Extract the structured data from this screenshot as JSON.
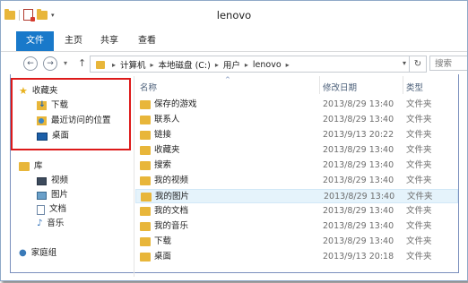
{
  "window": {
    "title": "lenovo"
  },
  "quick_access": {
    "dropdown_glyph": "▾"
  },
  "ribbon": {
    "tabs": [
      {
        "label": "文件"
      },
      {
        "label": "主页"
      },
      {
        "label": "共享"
      },
      {
        "label": "查看"
      }
    ]
  },
  "nav": {
    "back_glyph": "←",
    "forward_glyph": "→",
    "recent_glyph": "▾",
    "up_glyph": "↑",
    "breadcrumb": [
      "计算机",
      "本地磁盘 (C:)",
      "用户",
      "lenovo"
    ],
    "dropdown_glyph": "▾",
    "refresh_glyph": "↻",
    "search_placeholder": "搜索"
  },
  "sidebar": {
    "favorites_label": "收藏夹",
    "favorites": [
      {
        "label": "下载",
        "icon": "download-icon"
      },
      {
        "label": "最近访问的位置",
        "icon": "recent-places-icon"
      },
      {
        "label": "桌面",
        "icon": "desktop-icon"
      }
    ],
    "library_label": "库",
    "libraries": [
      {
        "label": "视频",
        "icon": "video-icon"
      },
      {
        "label": "图片",
        "icon": "picture-icon"
      },
      {
        "label": "文档",
        "icon": "document-icon"
      },
      {
        "label": "音乐",
        "icon": "music-icon"
      }
    ],
    "homegroup_label": "家庭组"
  },
  "columns": {
    "name": "名称",
    "date": "修改日期",
    "type": "类型"
  },
  "files": [
    {
      "name": "保存的游戏",
      "date": "2013/8/29 13:40",
      "type": "文件夹",
      "icon": "folder-games-icon"
    },
    {
      "name": "联系人",
      "date": "2013/8/29 13:40",
      "type": "文件夹",
      "icon": "folder-contacts-icon"
    },
    {
      "name": "链接",
      "date": "2013/9/13 20:22",
      "type": "文件夹",
      "icon": "folder-links-icon"
    },
    {
      "name": "收藏夹",
      "date": "2013/8/29 13:40",
      "type": "文件夹",
      "icon": "folder-favorites-icon"
    },
    {
      "name": "搜索",
      "date": "2013/8/29 13:40",
      "type": "文件夹",
      "icon": "folder-search-icon"
    },
    {
      "name": "我的视频",
      "date": "2013/8/29 13:40",
      "type": "文件夹",
      "icon": "folder-videos-icon"
    },
    {
      "name": "我的图片",
      "date": "2013/8/29 13:40",
      "type": "文件夹",
      "icon": "folder-pictures-icon",
      "selected": true
    },
    {
      "name": "我的文档",
      "date": "2013/8/29 13:40",
      "type": "文件夹",
      "icon": "folder-documents-icon"
    },
    {
      "name": "我的音乐",
      "date": "2013/8/29 13:40",
      "type": "文件夹",
      "icon": "folder-music-icon"
    },
    {
      "name": "下载",
      "date": "2013/8/29 13:40",
      "type": "文件夹",
      "icon": "folder-downloads-icon"
    },
    {
      "name": "桌面",
      "date": "2013/9/13 20:18",
      "type": "文件夹",
      "icon": "folder-desktop-icon"
    }
  ],
  "colors": {
    "accent": "#1979ca",
    "folder": "#e8b63a",
    "highlight_box": "#dd1a1a",
    "selection": "#e5f3fb"
  }
}
